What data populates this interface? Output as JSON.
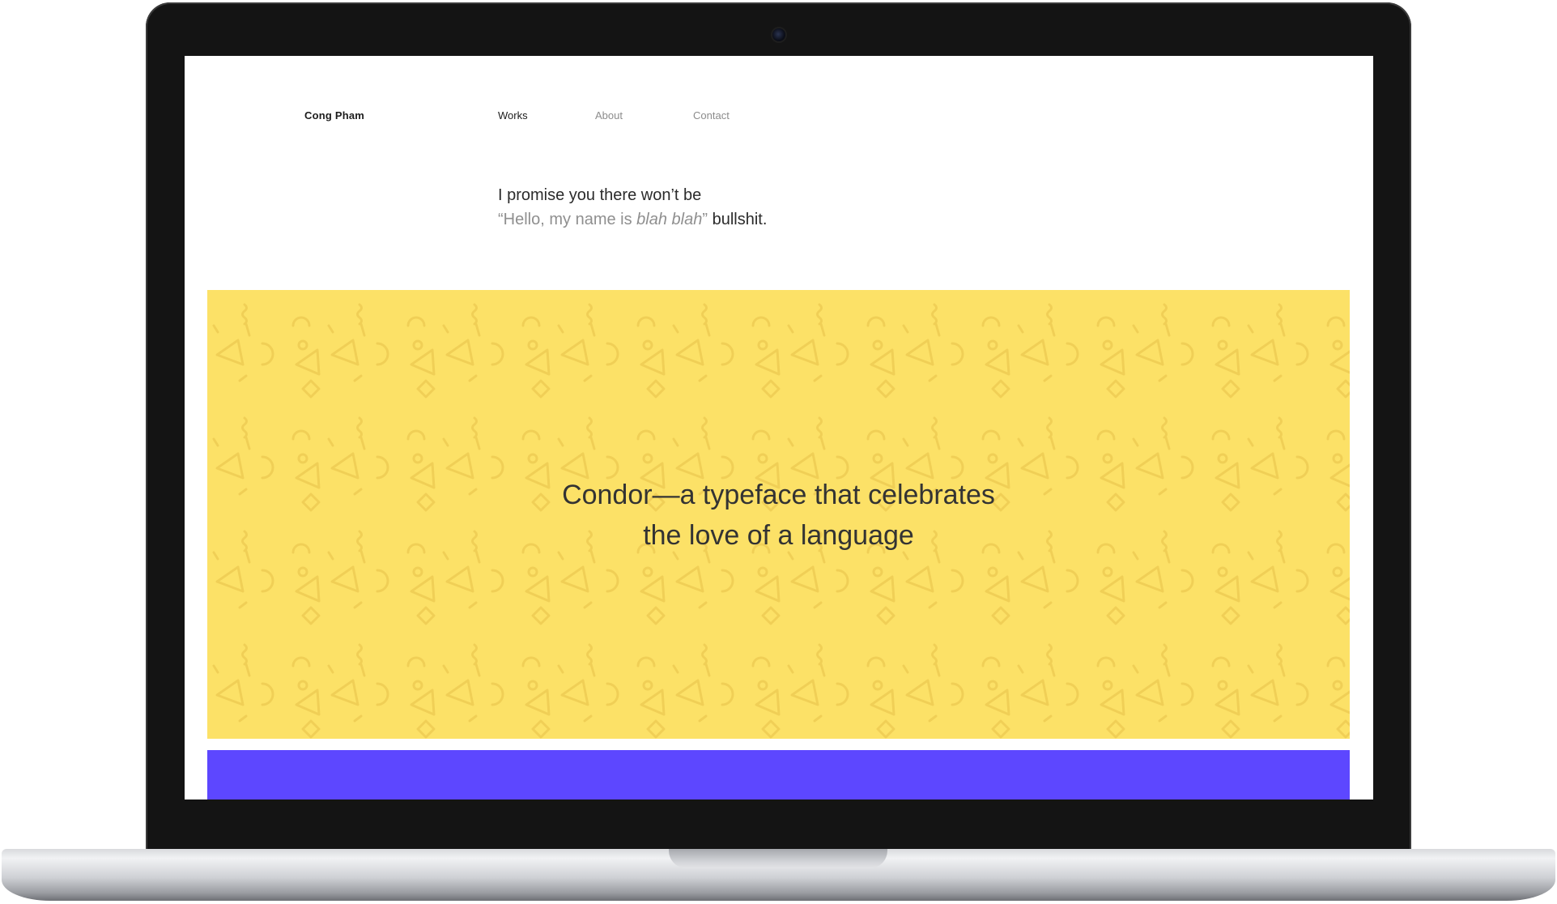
{
  "site": {
    "logo": "Cong Pham"
  },
  "nav": {
    "items": [
      {
        "label": "Works",
        "active": true
      },
      {
        "label": "About",
        "active": false
      },
      {
        "label": "Contact",
        "active": false
      }
    ]
  },
  "intro": {
    "line1": "I promise you there won’t be",
    "quote_open": "“Hello, my name is ",
    "quote_italic": "blah blah",
    "quote_close": "”",
    "tail": " bullshit."
  },
  "hero": {
    "title_line1": "Condor—a typeface that celebrates",
    "title_line2": "the love of a language",
    "background_color": "#fce167",
    "pattern": "memphis-shapes-pattern"
  },
  "next_block": {
    "color": "#5d47ff"
  },
  "colors": {
    "text_primary": "#1c1c1c",
    "text_muted": "#8c8c8c"
  }
}
